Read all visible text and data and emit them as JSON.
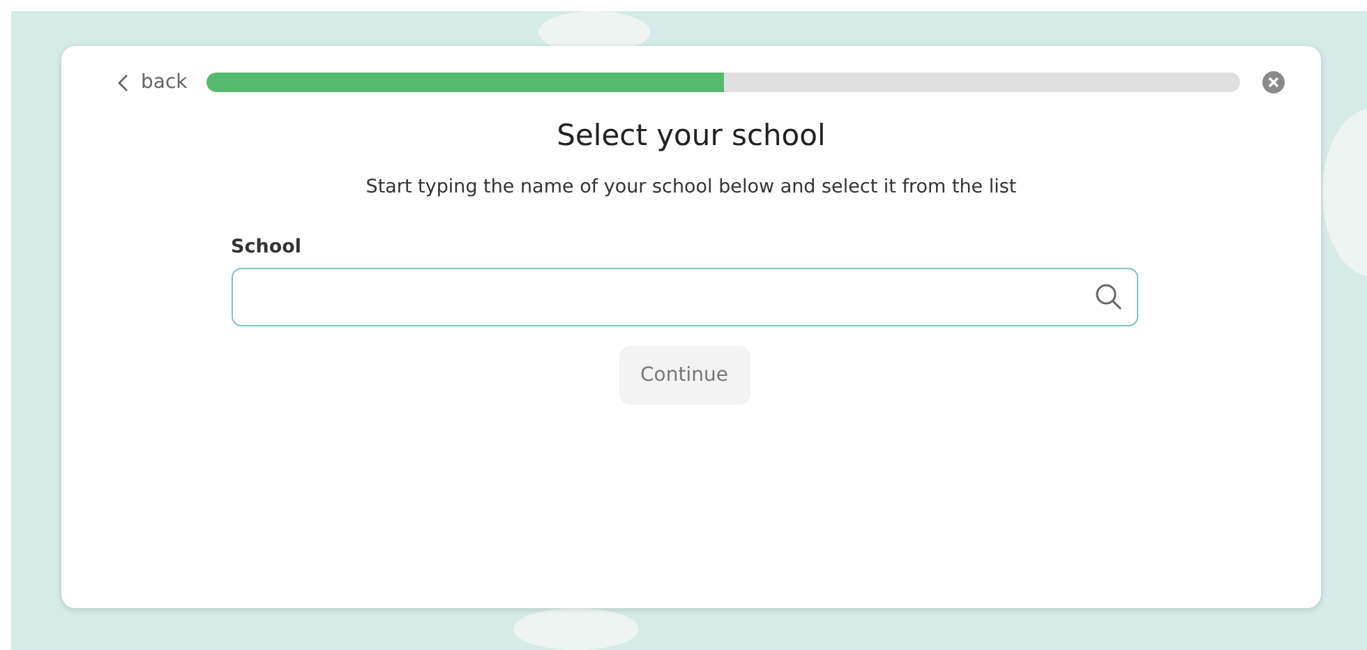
{
  "header": {
    "back_label": "back",
    "progress": {
      "level": 0.5
    }
  },
  "title": "Select your school",
  "subtitle": "Start typing the name of your school below and select it from the list",
  "field": {
    "label": "School"
  },
  "continue_button": {
    "label": "Continue",
    "disabled": true
  }
}
